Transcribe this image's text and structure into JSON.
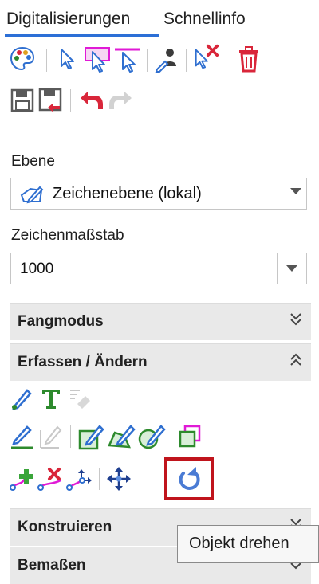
{
  "tabs": [
    {
      "label": "Digitalisierungen",
      "active": true
    },
    {
      "label": "Schnellinfo",
      "active": false
    }
  ],
  "layer": {
    "label": "Ebene",
    "value": "Zeichenebene (lokal)"
  },
  "scale": {
    "label": "Zeichenmaßstab",
    "value": "1000"
  },
  "sections": [
    {
      "title": "Fangmodus",
      "state": "collapsed"
    },
    {
      "title": "Erfassen / Ändern",
      "state": "expanded"
    },
    {
      "title": "Konstruieren",
      "state": "collapsed"
    },
    {
      "title": "Bemaßen",
      "state": "collapsed"
    }
  ],
  "tooltip": {
    "text": "Objekt drehen"
  },
  "colors": {
    "accent": "#2c6fd6",
    "highlight": "#c0141c",
    "section_bg": "#e9e9e9",
    "icon_green": "#2d8a2d",
    "icon_blue": "#2f6fd0",
    "icon_red": "#d9263a",
    "icon_magenta": "#e01ad6"
  },
  "toolbar_icons": [
    "palette-icon",
    "select-pointer-icon",
    "select-rectangle-icon",
    "select-line-icon",
    "person-edit-icon",
    "deselect-icon",
    "delete-icon",
    "save-icon",
    "save-as-icon",
    "undo-icon",
    "redo-icon"
  ],
  "edit_icons": [
    "pencil-icon",
    "text-icon",
    "eraser-icon",
    "draw-line-icon",
    "draw-polyline-icon",
    "edit-area-icon",
    "edit-shape-icon",
    "edit-circle-icon",
    "copy-object-icon",
    "add-vertex-icon",
    "remove-vertex-icon",
    "move-vertex-icon",
    "move-object-icon",
    "rotate-object-icon"
  ]
}
